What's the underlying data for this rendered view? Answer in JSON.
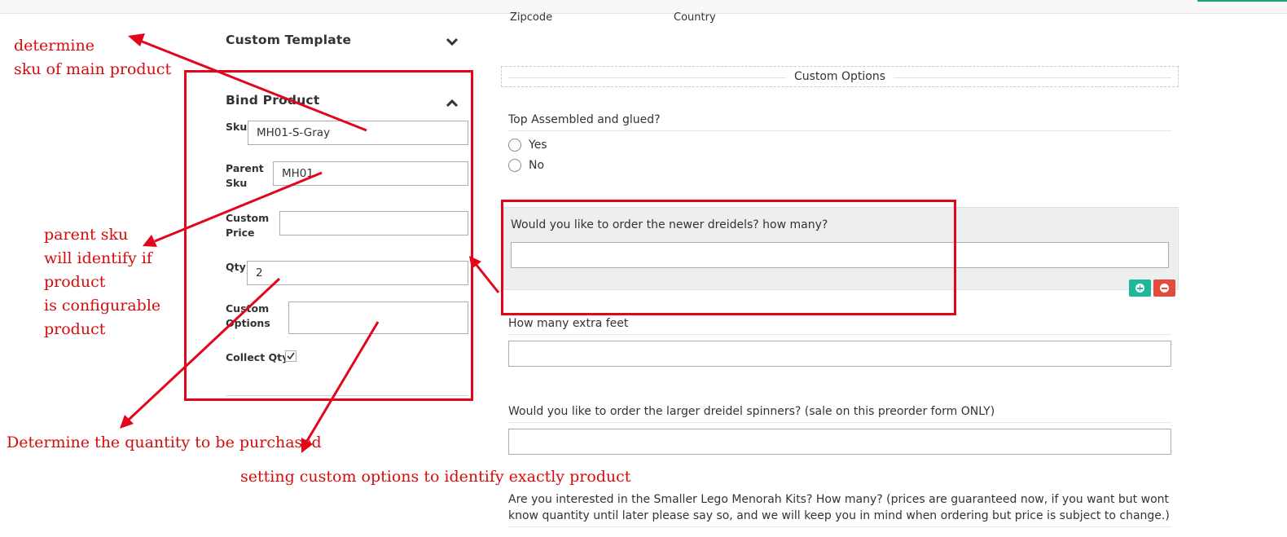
{
  "header": {
    "zipcode_label": "Zipcode",
    "country_label": "Country"
  },
  "left_panel": {
    "custom_template_title": "Custom Template",
    "bind_product_title": "Bind Product",
    "fields": {
      "sku_label": "Sku",
      "sku_value": "MH01-S-Gray",
      "parent_sku_line1": "Parent",
      "parent_sku_line2": "Sku",
      "parent_sku_value": "MH01",
      "custom_price_line1": "Custom",
      "custom_price_line2": "Price",
      "custom_price_value": "",
      "qty_label": "Qty",
      "qty_value": "2",
      "custom_options_line1": "Custom",
      "custom_options_line2": "Options",
      "custom_options_value": "",
      "collect_qty_label": "Collect Qty",
      "collect_qty_checked": true
    }
  },
  "form": {
    "section_legend": "Custom Options",
    "q1": {
      "label": "Top Assembled and glued?",
      "options": [
        "Yes",
        "No"
      ]
    },
    "q2": {
      "label": "Would you like to order the newer dreidels? how many?",
      "value": ""
    },
    "q3": {
      "label": "How many extra feet",
      "value": ""
    },
    "q4": {
      "label": "Would you like to order the larger dreidel spinners? (sale on this preorder form ONLY)",
      "value": ""
    },
    "q5": {
      "label": "Are you interested in the Smaller Lego Menorah Kits? How many? (prices are guaranteed now, if you want but wont know quantity until later please say so, and we will keep you in mind when ordering but price is subject to change.)"
    },
    "add_icon": "plus-circle-icon",
    "remove_icon": "minus-circle-icon",
    "add_color": "#1db79a",
    "remove_color": "#e34b3f"
  },
  "annotations": {
    "sku_note": [
      "determine",
      "sku of main product"
    ],
    "parent_note": [
      "parent sku",
      "will identify if",
      "product",
      "is configurable",
      "product"
    ],
    "qty_note": "Determine the quantity to be purchased",
    "options_note": "setting custom options to identify exactly product",
    "color": "#d40c0c"
  }
}
